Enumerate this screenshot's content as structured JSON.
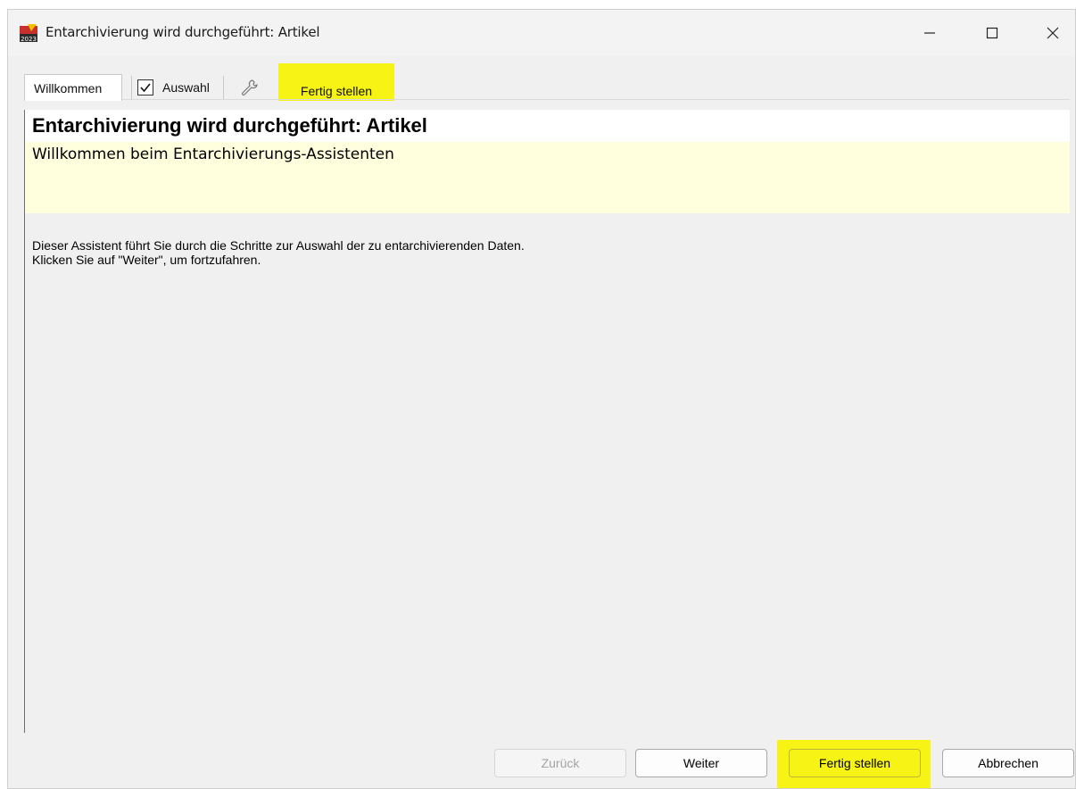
{
  "window": {
    "title": "Entarchivierung wird durchgeführt: Artikel",
    "app_icon": "app-2023-icon"
  },
  "window_controls": {
    "minimize": "minimize-icon",
    "maximize": "maximize-icon",
    "close": "close-icon"
  },
  "tabs": [
    {
      "label": "Willkommen",
      "active": true
    },
    {
      "label": "Auswahl",
      "checked": true
    },
    {
      "label": "",
      "icon": "wrench-icon"
    },
    {
      "label": "Fertig stellen",
      "highlighted": true
    }
  ],
  "page": {
    "title": "Entarchivierung wird durchgeführt: Artikel",
    "subtitle": "Willkommen beim Entarchivierungs-Assistenten",
    "description_line1": "Dieser Assistent führt Sie durch die Schritte zur Auswahl der zu entarchivierenden Daten.",
    "description_line2": "Klicken Sie auf \"Weiter\", um fortzufahren."
  },
  "buttons": {
    "back": "Zurück",
    "next": "Weiter",
    "finish": "Fertig stellen",
    "cancel": "Abbrechen"
  },
  "colors": {
    "highlight": "#f7f314",
    "subtitle_band": "#fffedd",
    "window_bg": "#f0f0f0"
  }
}
